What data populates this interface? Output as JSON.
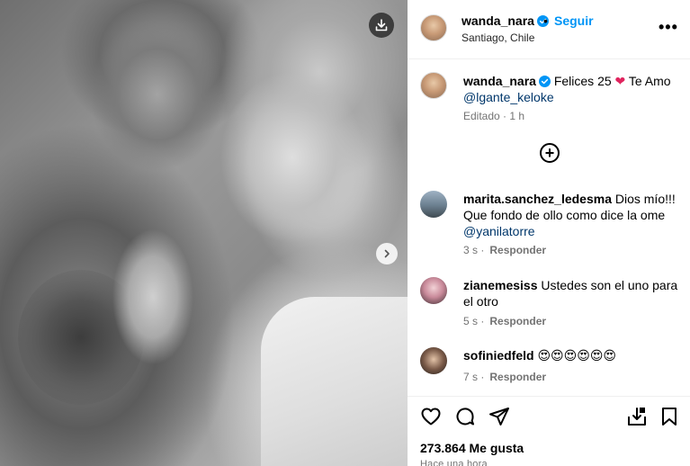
{
  "header": {
    "username": "wanda_nara",
    "dot": "•",
    "follow_label": "Seguir",
    "location": "Santiago, Chile",
    "more_label": "•••"
  },
  "caption": {
    "username": "wanda_nara",
    "text_before": "Felices 25",
    "heart": "❤",
    "text_after": "Te Amo",
    "mention": "@lgante_keloke",
    "meta": "Editado · 1 h"
  },
  "add_more_label": "+",
  "comments": [
    {
      "username": "marita.sanchez_ledesma",
      "text": "Dios mío!!! Que fondo de ollo como dice la ome",
      "mention": "@yanilatorre",
      "time": "3 s",
      "reply_label": "Responder"
    },
    {
      "username": "zianemesiss",
      "text": "Ustedes son el uno para el otro",
      "mention": "",
      "time": "5 s",
      "reply_label": "Responder"
    },
    {
      "username": "sofiniedfeld",
      "text": "😍😍😍😍😍😍",
      "mention": "",
      "time": "7 s",
      "reply_label": "Responder"
    }
  ],
  "likes": "273.864 Me gusta",
  "time_ago": "Hace una hora",
  "icons": {
    "download": "download-icon",
    "next": "chevron-right-icon",
    "like": "heart-icon",
    "comment": "comment-icon",
    "share": "send-icon",
    "save_collection": "save-to-collection-icon",
    "bookmark": "bookmark-icon"
  },
  "colors": {
    "accent": "#0095f6",
    "verified": "#0095f6",
    "heart": "#e0245e",
    "mention": "#00376b",
    "muted": "#737373"
  }
}
